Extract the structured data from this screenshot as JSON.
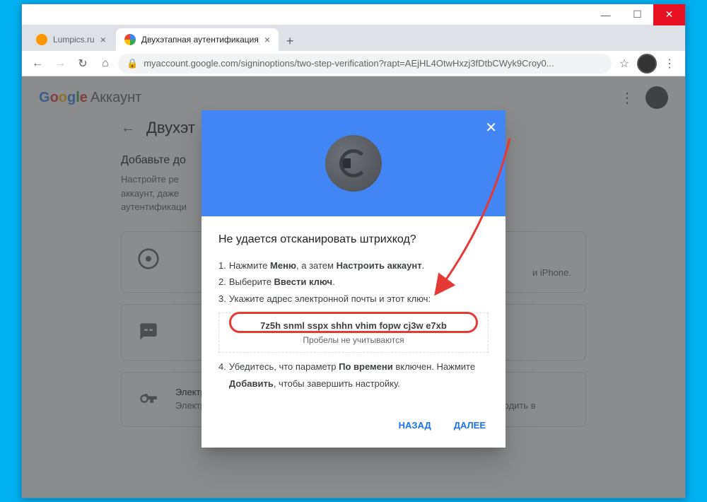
{
  "window": {
    "min": "—",
    "max": "☐",
    "close": "✕"
  },
  "tabs": [
    {
      "title": "Lumpics.ru"
    },
    {
      "title": "Двухэтапная аутентификация"
    }
  ],
  "url": "myaccount.google.com/signinoptions/two-step-verification?rapt=AEjHL4OtwHxzj3fDtbCWyk9Croy0...",
  "header": {
    "brand_account": "Аккаунт"
  },
  "page": {
    "title": "Двухэт",
    "section_title": "Добавьте до",
    "section_desc_1": "Настройте ре",
    "section_desc_2": "аккаунт, даже",
    "section_desc_3": "аутентификаци",
    "card_iphone": "и iPhone.",
    "card3_title": "Электронный ключ",
    "card3_desc": "Электронный ключ – это способ подтверждения, позволяющий безопасно входить в"
  },
  "dialog": {
    "title": "Не удается отсканировать штрихкод?",
    "li1_a": "Нажмите ",
    "li1_b": "Меню",
    "li1_c": ", а затем ",
    "li1_d": "Настроить аккаунт",
    "li1_e": ".",
    "li2_a": "Выберите ",
    "li2_b": "Ввести ключ",
    "li2_c": ".",
    "li3": "Укажите адрес электронной почты и этот ключ:",
    "key": "7z5h snml sspx shhn vhim fopw cj3w e7xb",
    "key_note": "Пробелы не учитываются",
    "li4_a": "Убедитесь, что параметр ",
    "li4_b": "По времени",
    "li4_c": " включен. Нажмите ",
    "li4_d": "Добавить",
    "li4_e": ", чтобы завершить настройку.",
    "back": "Назад",
    "next": "Далее"
  }
}
